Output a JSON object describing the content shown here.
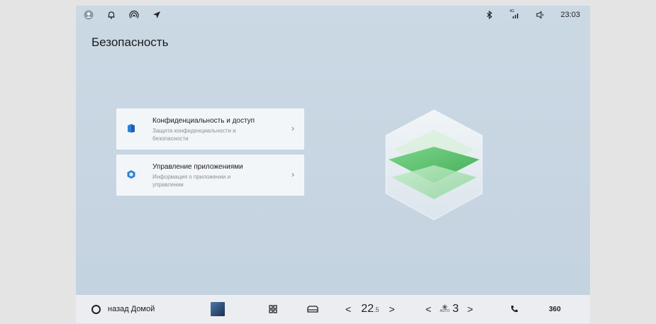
{
  "status_bar": {
    "left_icons": [
      "user-icon",
      "bell-icon",
      "hotspot-icon",
      "navigation-arrow-icon"
    ],
    "right_icons": [
      "bluetooth-icon",
      "signal-4g-icon",
      "volume-icon"
    ],
    "network_label": "4G",
    "time": "23:03"
  },
  "page": {
    "title": "Безопасность"
  },
  "cards": [
    {
      "title": "Конфиденциальность и доступ",
      "subtitle": "Защита конфиденциальности и безопасности",
      "icon": "shield-icon",
      "icon_color": "#2f7fd6"
    },
    {
      "title": "Управление приложениями",
      "subtitle": "Информация о приложении и управлении",
      "icon": "app-cube-icon",
      "icon_color": "#2f7fd6"
    }
  ],
  "hero": {
    "icon": "layers-cube-icon",
    "accent": "#5cc36e"
  },
  "navbar": {
    "back_label": "назад Домой",
    "temperature": "22",
    "temperature_decimal": ".5",
    "fan_auto_label": "AUTO",
    "fan_level": "3",
    "camera_label": "360",
    "icons": [
      "home-circle-icon",
      "album-art",
      "apps-grid-icon",
      "car-seat-icon",
      "chevron-left-icon",
      "chevron-right-icon",
      "fan-icon",
      "phone-icon",
      "camera-360-icon"
    ]
  },
  "colors": {
    "background": "#c8d7e3",
    "card_bg": "#f4f5f6",
    "navbar_bg": "#ebedf0",
    "accent_blue": "#2f7fd6",
    "accent_green": "#5cc36e"
  }
}
